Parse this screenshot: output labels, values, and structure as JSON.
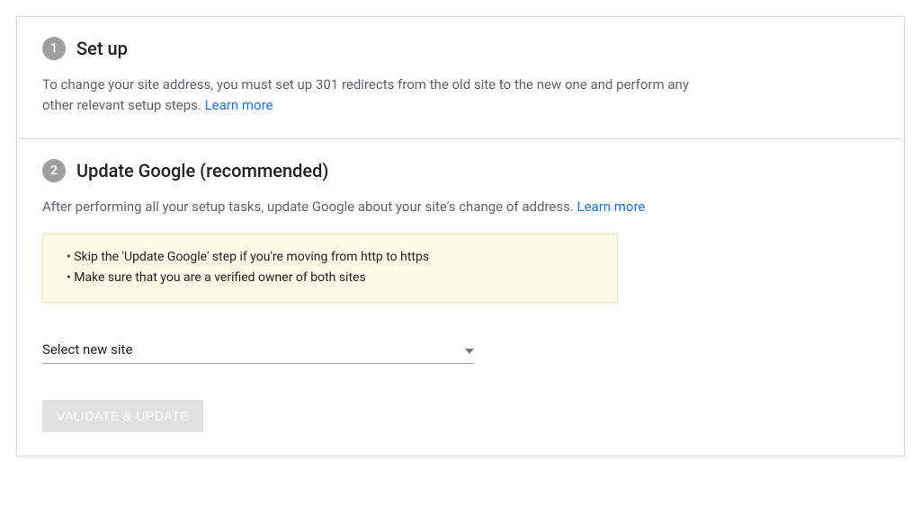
{
  "steps": [
    {
      "num": "1",
      "title": "Set up",
      "body": "To change your site address, you must set up 301 redirects from the old site to the new one and perform any other relevant setup steps.",
      "learn_more": "Learn more"
    },
    {
      "num": "2",
      "title": "Update Google (recommended)",
      "body": "After performing all your setup tasks, update Google about your site's change of address.",
      "learn_more": "Learn more",
      "notes": [
        "Skip the 'Update Google' step if you're moving from http to https",
        "Make sure that you are a verified owner of both sites"
      ],
      "select_label": "Select new site",
      "button_label": "VALIDATE & UPDATE"
    }
  ]
}
